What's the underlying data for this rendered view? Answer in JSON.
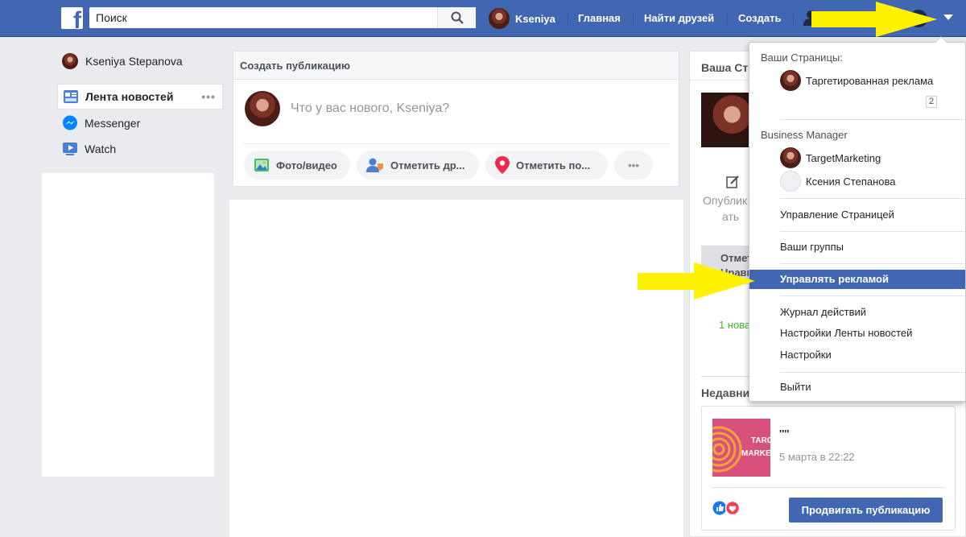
{
  "topbar": {
    "search_placeholder": "Поиск",
    "user_name": "Kseniya",
    "home": "Главная",
    "find_friends": "Найти друзей",
    "create": "Создать"
  },
  "left": {
    "profile_name": "Kseniya Stepanova",
    "items": [
      {
        "label": "Лента новостей"
      },
      {
        "label": "Messenger"
      },
      {
        "label": "Watch"
      }
    ]
  },
  "composer": {
    "title": "Создать публикацию",
    "prompt": "Что у вас нового, Kseniya?",
    "actions": [
      "Фото/видео",
      "Отметить др...",
      "Отметить по..."
    ],
    "more": "•••"
  },
  "right": {
    "pages_title": "Ваша Ст",
    "publish_label_1": "Опублик",
    "publish_label_2": "ать",
    "mark_label_1": "Отмет",
    "mark_label_2": "Нравит",
    "new_label": "1 нова",
    "recent_title": "Недавни",
    "post_title": "''''",
    "post_time": "5 марта в 22:22",
    "thumb_text_1": "TARG",
    "thumb_text_2": "MARKE",
    "promote_button": "Продвигать публикацию"
  },
  "dropdown": {
    "your_pages_header": "Ваши Страницы:",
    "page_name": "Таргетированная реклама",
    "page_badge": "2",
    "bm_header": "Business Manager",
    "bm_items": [
      "TargetMarketing",
      "Ксения Степанова"
    ],
    "manage_page": "Управление Страницей",
    "your_groups": "Ваши группы",
    "manage_ads": "Управлять рекламой",
    "activity_log": "Журнал действий",
    "news_feed_settings": "Настройки Ленты новостей",
    "settings": "Настройки",
    "logout": "Выйти"
  },
  "colors": {
    "brand_blue": "#4267b2",
    "highlight_arrow": "#fff200",
    "thumb_bg": "#d9507a",
    "thumb_ring": "#f0a23b"
  }
}
